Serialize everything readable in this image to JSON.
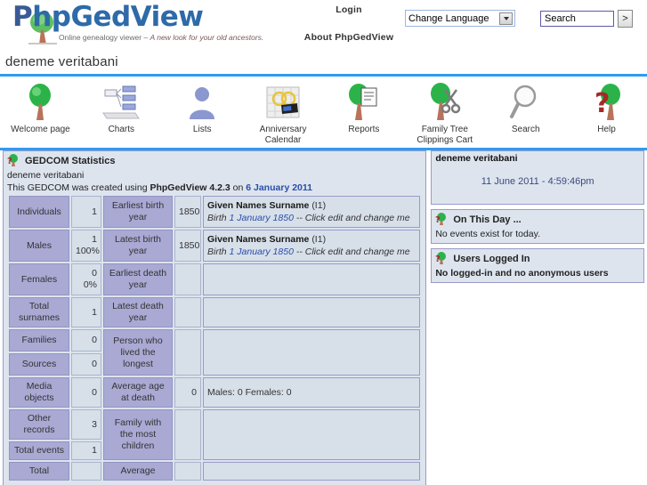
{
  "header": {
    "logo_text_1": "P",
    "logo_text_2": "hpGedView",
    "tagline_plain": "Online genealogy viewer – ",
    "tagline_italic": "A new look for your old ancestors.",
    "login_label": "Login",
    "about_label": "About PhpGedView",
    "language_selected": "Change Language",
    "search_value": "Search",
    "search_go_label": ">"
  },
  "page_title": "deneme veritabani",
  "nav": [
    {
      "label": "Welcome page",
      "icon": "tree-icon"
    },
    {
      "label": "Charts",
      "icon": "chart-icon"
    },
    {
      "label": "Lists",
      "icon": "person-icon"
    },
    {
      "label": "Anniversary Calendar",
      "icon": "calendar-icon"
    },
    {
      "label": "Reports",
      "icon": "report-icon"
    },
    {
      "label": "Family Tree Clippings Cart",
      "icon": "scissors-icon"
    },
    {
      "label": "Search",
      "icon": "magnifier-icon"
    },
    {
      "label": "Help",
      "icon": "question-icon"
    }
  ],
  "gedcom_panel": {
    "title": "GEDCOM Statistics",
    "icon": "tree-icon",
    "database_name": "deneme veritabani",
    "created_prefix": "This GEDCOM was created using ",
    "created_app": "PhpGedView 4.2.3",
    "created_middle": " on ",
    "created_date": "6 January 2011"
  },
  "stats_left": [
    {
      "label": "Individuals",
      "value": "1",
      "value2": ""
    },
    {
      "label": "Males",
      "value": "1",
      "value2": "100%"
    },
    {
      "label": "Females",
      "value": "0",
      "value2": "0%"
    },
    {
      "label": "Total surnames",
      "value": "1",
      "value2": ""
    },
    {
      "label": "Families",
      "value": "0",
      "value2": ""
    },
    {
      "label": "Sources",
      "value": "0",
      "value2": ""
    },
    {
      "label": "Media objects",
      "value": "0",
      "value2": ""
    },
    {
      "label": "Other records",
      "value": "3",
      "value2": ""
    },
    {
      "label": "Total events",
      "value": "1",
      "value2": ""
    },
    {
      "label": "Total",
      "value": "",
      "value2": ""
    }
  ],
  "stats_right": [
    {
      "label": "Earliest birth year",
      "value": "1850",
      "person_name": "Given Names Surname",
      "person_id": "(I1)",
      "event_prefix": "Birth ",
      "event_date": "1 January 1850",
      "event_suffix": " -- Click edit and change me"
    },
    {
      "label": "Latest birth year",
      "value": "1850",
      "person_name": "Given Names Surname",
      "person_id": "(I1)",
      "event_prefix": "Birth ",
      "event_date": "1 January 1850",
      "event_suffix": " -- Click edit and change me"
    },
    {
      "label": "Earliest death year",
      "value": "",
      "detail": ""
    },
    {
      "label": "Latest death year",
      "value": "",
      "detail": ""
    },
    {
      "label": "Person who lived the longest",
      "value": "",
      "detail": ""
    },
    {
      "label": "Average age at death",
      "value": "0",
      "detail": "Males: 0   Females: 0"
    },
    {
      "label": "Family with the most children",
      "value": "",
      "detail": ""
    },
    {
      "label": "Average",
      "value": "",
      "detail": ""
    }
  ],
  "sidebar": {
    "db_panel": {
      "title": "deneme veritabani",
      "datetime": "11 June 2011 - 4:59:46pm"
    },
    "onthisday_panel": {
      "title": "On This Day ...",
      "icon": "tree-icon",
      "text": "No events exist for today."
    },
    "users_panel": {
      "title": "Users Logged In",
      "icon": "tree-icon",
      "text": "No logged-in and no anonymous users"
    }
  },
  "colors": {
    "rule_blue": "#2e9cf0",
    "label_cell": "#a9a9d4",
    "value_cell": "#d7dfe9",
    "panel_border": "#9a9ac8",
    "link_blue": "#2b4ea8",
    "logo_blue": "#3a5a96",
    "tree_green": "#3cb54a",
    "trunk_brown": "#b06a52"
  }
}
